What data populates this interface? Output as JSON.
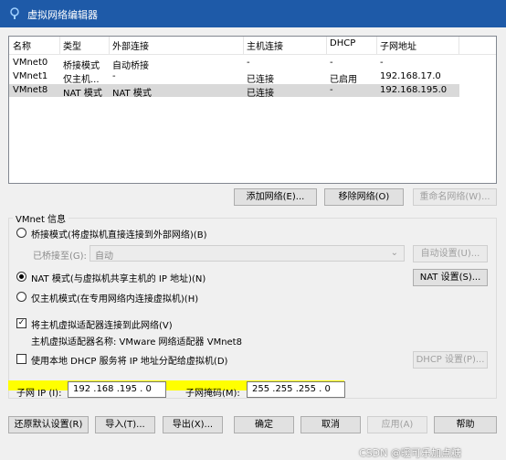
{
  "window": {
    "title": "虚拟网络编辑器",
    "icon": "network-icon",
    "accent": "#1e5aa8"
  },
  "table": {
    "headers": [
      "名称",
      "类型",
      "外部连接",
      "主机连接",
      "DHCP",
      "子网地址"
    ],
    "rows": [
      [
        "VMnet0",
        "桥接模式",
        "自动桥接",
        "-",
        "-",
        "-"
      ],
      [
        "VMnet1",
        "仅主机...",
        "-",
        "已连接",
        "已启用",
        "192.168.17.0"
      ],
      [
        "VMnet8",
        "NAT 模式",
        "NAT 模式",
        "已连接",
        "-",
        "192.168.195.0"
      ]
    ],
    "selected_row": 2
  },
  "table_buttons": {
    "add": "添加网络(E)...",
    "remove": "移除网络(O)",
    "rename": "重命名网络(W)..."
  },
  "vmnet_info": {
    "group_label": "VMnet 信息",
    "bridge_radio": "桥接模式(将虚拟机直接连接到外部网络)(B)",
    "bridged_to_label": "已桥接至(G):",
    "bridged_to_value": "自动",
    "auto_settings": "自动设置(U)...",
    "nat_radio": "NAT 模式(与虚拟机共享主机的 IP 地址)(N)",
    "nat_settings": "NAT 设置(S)...",
    "host_only_radio": "仅主机模式(在专用网络内连接虚拟机)(H)",
    "selected_mode": "nat",
    "connect_adapter": "将主机虚拟适配器连接到此网络(V)",
    "connect_adapter_checked": true,
    "adapter_name": "主机虚拟适配器名称: VMware 网络适配器 VMnet8",
    "use_dhcp": "使用本地 DHCP 服务将 IP 地址分配给虚拟机(D)",
    "use_dhcp_checked": false,
    "dhcp_settings": "DHCP 设置(P)...",
    "subnet_ip_label": "子网 IP (I):",
    "subnet_ip": "192 .168 .195 . 0",
    "subnet_mask_label": "子网掩码(M):",
    "subnet_mask": "255 .255 .255 . 0"
  },
  "footer": {
    "restore": "还原默认设置(R)",
    "import": "导入(T)...",
    "export": "导出(X)...",
    "ok": "确定",
    "cancel": "取消",
    "apply": "应用(A)",
    "help": "帮助"
  },
  "watermark": "CSDN @暖可乐加点糖"
}
